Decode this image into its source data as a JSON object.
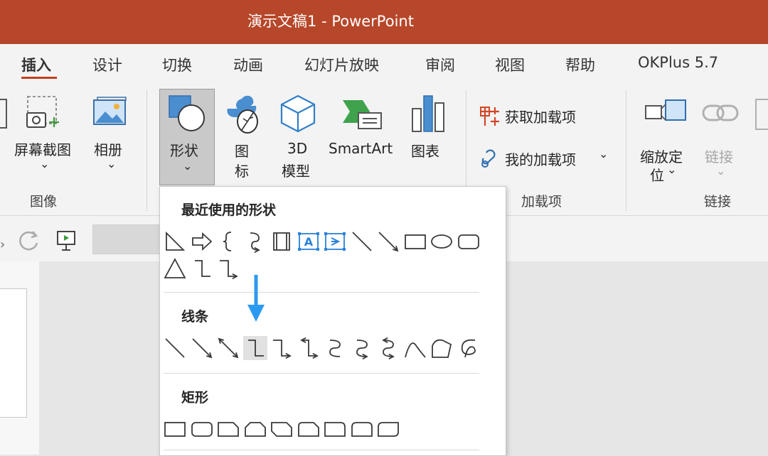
{
  "window": {
    "title": "演示文稿1  -  PowerPoint"
  },
  "tabs": [
    "插入",
    "设计",
    "切换",
    "动画",
    "幻灯片放映",
    "审阅",
    "视图",
    "帮助",
    "OKPlus 5.7"
  ],
  "active_tab": "插入",
  "ribbon": {
    "images_group": {
      "label": "图像",
      "screenshot": "屏幕截图",
      "album": "相册",
      "chevron": "⌄"
    },
    "illustrations": {
      "shapes": "形状",
      "icons_line1": "图",
      "icons_line2": "标",
      "model_line1": "3D",
      "model_line2": "模型",
      "smartart": "SmartArt",
      "chart": "图表"
    },
    "addins_group": {
      "label": "加载项",
      "get_addins": "获取加载项",
      "my_addins": "我的加载项",
      "chevron": "⌄"
    },
    "links_group": {
      "label": "链接",
      "zoom_line1": "缩放定",
      "zoom_line2": "位",
      "link": "链接",
      "chevron": "⌄"
    }
  },
  "shapes_menu": {
    "sections": {
      "recent": "最近使用的形状",
      "lines": "线条",
      "rectangles": "矩形"
    },
    "recent_icons": [
      "right-triangle-icon",
      "block-arrow-right-icon",
      "left-brace-icon",
      "curved-connector-arrow-icon",
      "vertical-scroll-icon",
      "text-box-icon",
      "text-box-vertical-icon",
      "line-icon",
      "arrow-line-icon",
      "rectangle-icon",
      "oval-icon",
      "rounded-rectangle-icon",
      "triangle-icon",
      "elbow-connector-icon",
      "elbow-arrow-connector-icon"
    ],
    "line_icons": [
      "line-icon",
      "arrow-line-icon",
      "double-arrow-line-icon",
      "elbow-connector-icon",
      "elbow-arrow-connector-icon",
      "elbow-double-arrow-connector-icon",
      "curved-connector-icon",
      "curved-arrow-connector-icon",
      "curved-double-arrow-connector-icon",
      "curve-icon",
      "freeform-shape-icon",
      "freeform-scribble-icon"
    ],
    "rect_icons": [
      "rectangle-icon",
      "rounded-rectangle-icon",
      "snip-single-corner-rectangle-icon",
      "snip-same-side-rectangle-icon",
      "snip-diagonal-rectangle-icon",
      "snip-round-rectangle-icon",
      "round-single-corner-rectangle-icon",
      "round-same-side-rectangle-icon",
      "round-diagonal-rectangle-icon"
    ],
    "selected_line_icon": "elbow-connector-icon"
  },
  "colors": {
    "titlebar": "#b7472a",
    "accent": "#c43e1c",
    "annotation_arrow": "#2b9af3"
  }
}
